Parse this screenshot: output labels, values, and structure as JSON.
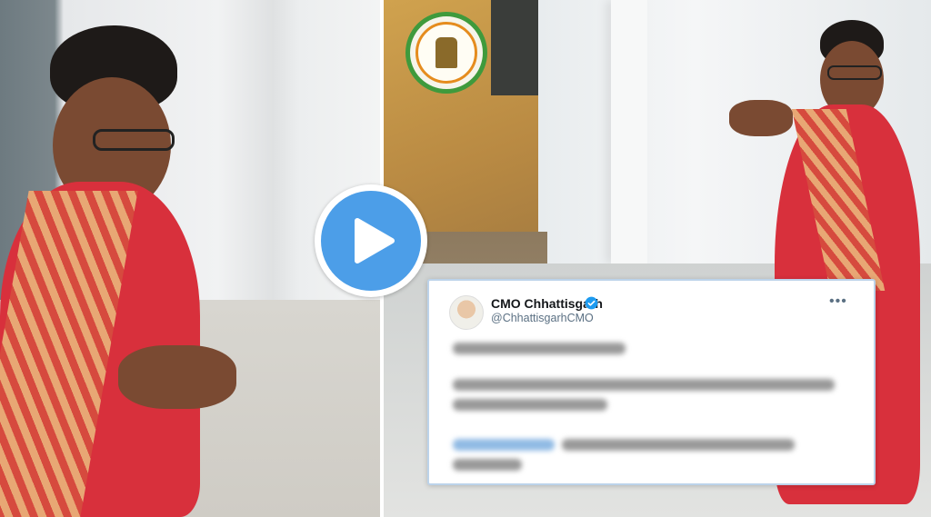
{
  "tweet": {
    "author_name": "CMO Chhattisgarh",
    "author_handle": "@ChhattisgarhCMO",
    "more_icon": "more-horizontal-icon",
    "verified_icon": "verified-badge-icon"
  },
  "player": {
    "play_icon": "play-icon"
  },
  "emblem": {
    "icon": "government-seal-emblem"
  },
  "colors": {
    "play_blue": "#4c9ee8",
    "verified_blue": "#1d9bf0",
    "sari_red": "#d8303c",
    "seal_green": "#3f9a3c",
    "seal_orange": "#e58c1e"
  }
}
